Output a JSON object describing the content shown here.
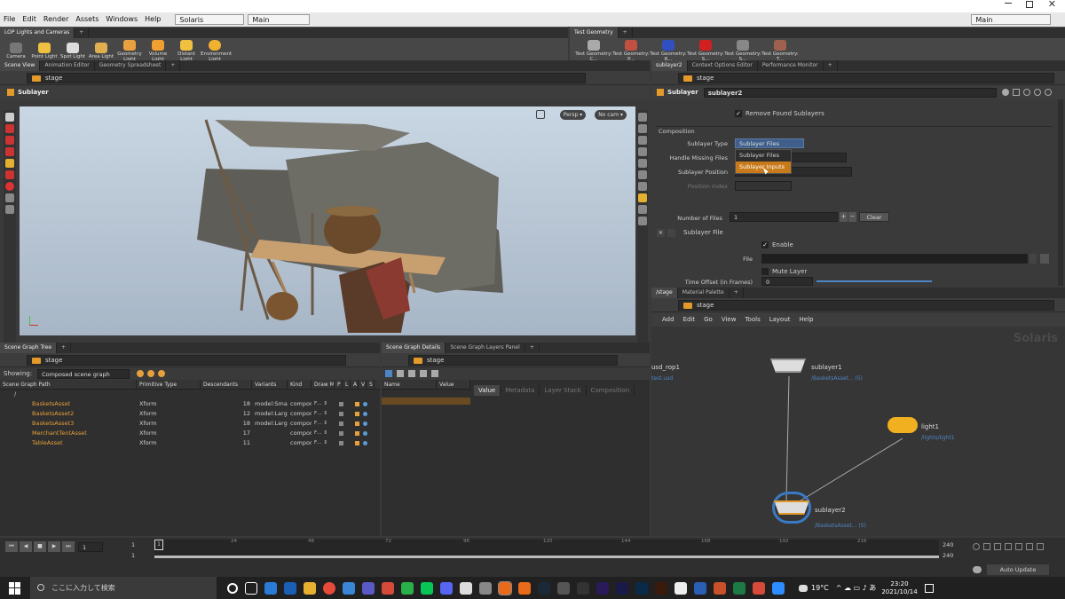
{
  "menu": {
    "items": [
      "File",
      "Edit",
      "Render",
      "Assets",
      "Windows",
      "Help"
    ],
    "desktop_label": "Solaris",
    "pane_label": "Main",
    "right_label": "Main"
  },
  "shelf_left": {
    "tab": "LOP Lights and Cameras",
    "tools": [
      "Camera",
      "Point Light",
      "Spot Light",
      "Area Light",
      "Geometry Light",
      "Volume Light",
      "Distant Light",
      "Environment Light"
    ]
  },
  "shelf_right": {
    "tab": "Test Geometry",
    "tools": [
      "Test Geometry: C...",
      "Test Geometry: P...",
      "Test Geometry: R...",
      "Test Geometry: S...",
      "Test Geometry: S...",
      "Test Geometry: T..."
    ]
  },
  "viewer": {
    "tabs": [
      "Scene View",
      "Animation Editor",
      "Geometry Spreadsheet"
    ],
    "path": "stage",
    "title": "Sublayer",
    "camera_persp": "Persp ▾",
    "camera_cam": "No cam ▾"
  },
  "params": {
    "tabs": [
      "sublayer2",
      "Context Options Editor",
      "Performance Monitor"
    ],
    "path": "stage",
    "node_type": "Sublayer",
    "node_name": "sublayer2",
    "remove_found": "Remove Found Sublayers",
    "section_composition": "Composition",
    "sublayer_type_label": "Sublayer Type",
    "sublayer_type_value": "Sublayer Files",
    "handle_missing_label": "Handle Missing Files",
    "handle_missing_value": "ies",
    "sublayer_position_label": "Sublayer Position",
    "position_index_label": "Position Index",
    "menu_options": [
      "Sublayer Files",
      "Sublayer Inputs"
    ],
    "number_of_files_label": "Number of Files",
    "number_of_files_value": "1",
    "clear_label": "Clear",
    "sublayer_file_label": "Sublayer File",
    "enable_label": "Enable",
    "file_label": "File",
    "mute_layer_label": "Mute Layer",
    "time_offset_label": "Time Offset (in Frames)",
    "time_offset_value": "0"
  },
  "network": {
    "tabs": [
      "/stage",
      "Material Palette"
    ],
    "path": "stage",
    "menu": [
      "Add",
      "Edit",
      "Go",
      "View",
      "Tools",
      "Layout",
      "Help"
    ],
    "watermark": "Solaris",
    "nodes": {
      "usd_rop1": {
        "name": "usd_rop1",
        "sub": "test.usd"
      },
      "sublayer1": {
        "name": "sublayer1",
        "sub": "/BasketsAsset... (5)"
      },
      "light1": {
        "name": "light1",
        "sub": "/lights/light1"
      },
      "sublayer2": {
        "name": "sublayer2",
        "sub": "/BasketsAsset... (5)"
      }
    }
  },
  "scene_graph": {
    "tabs": [
      "Scene Graph Tree"
    ],
    "path": "stage",
    "showing_label": "Showing:",
    "showing_value": "Composed scene graph",
    "columns": [
      "Scene Graph Path",
      "Primitive Type",
      "Descendants",
      "Variants",
      "Kind",
      "Draw M",
      "P",
      "L",
      "A",
      "V",
      "S"
    ],
    "root": "/",
    "rows": [
      {
        "path": "BasketsAsset",
        "type": "Xform",
        "desc": "18",
        "variants": "model:Small",
        "kind": "compon"
      },
      {
        "path": "BasketsAsset2",
        "type": "Xform",
        "desc": "12",
        "variants": "model:Large",
        "kind": "compon"
      },
      {
        "path": "BasketsAsset3",
        "type": "Xform",
        "desc": "18",
        "variants": "model:Large",
        "kind": "compon"
      },
      {
        "path": "MerchantTentAsset",
        "type": "Xform",
        "desc": "17",
        "variants": "",
        "kind": "compon"
      },
      {
        "path": "TableAsset",
        "type": "Xform",
        "desc": "11",
        "variants": "",
        "kind": "compon"
      }
    ]
  },
  "details": {
    "tabs": [
      "Scene Graph Details",
      "Scene Graph Layers Panel"
    ],
    "path": "stage",
    "columns": [
      "Name",
      "Value"
    ],
    "subtabs": [
      "Value",
      "Metadata",
      "Layer Stack",
      "Composition"
    ]
  },
  "timeline": {
    "frame": "1",
    "start": "1",
    "start2": "1",
    "ticks": [
      "1",
      "24",
      "48",
      "72",
      "96",
      "120",
      "144",
      "168",
      "192",
      "216"
    ],
    "end": "240",
    "end2": "240",
    "auto_update": "Auto Update"
  },
  "taskbar": {
    "search_placeholder": "ここに入力して検索",
    "weather": "19°C",
    "time": "23:20",
    "date": "2021/10/14"
  },
  "colors": {
    "accent": "#e39a2a",
    "node_blue": "#4d86c4",
    "highlight": "#c87a1a"
  }
}
